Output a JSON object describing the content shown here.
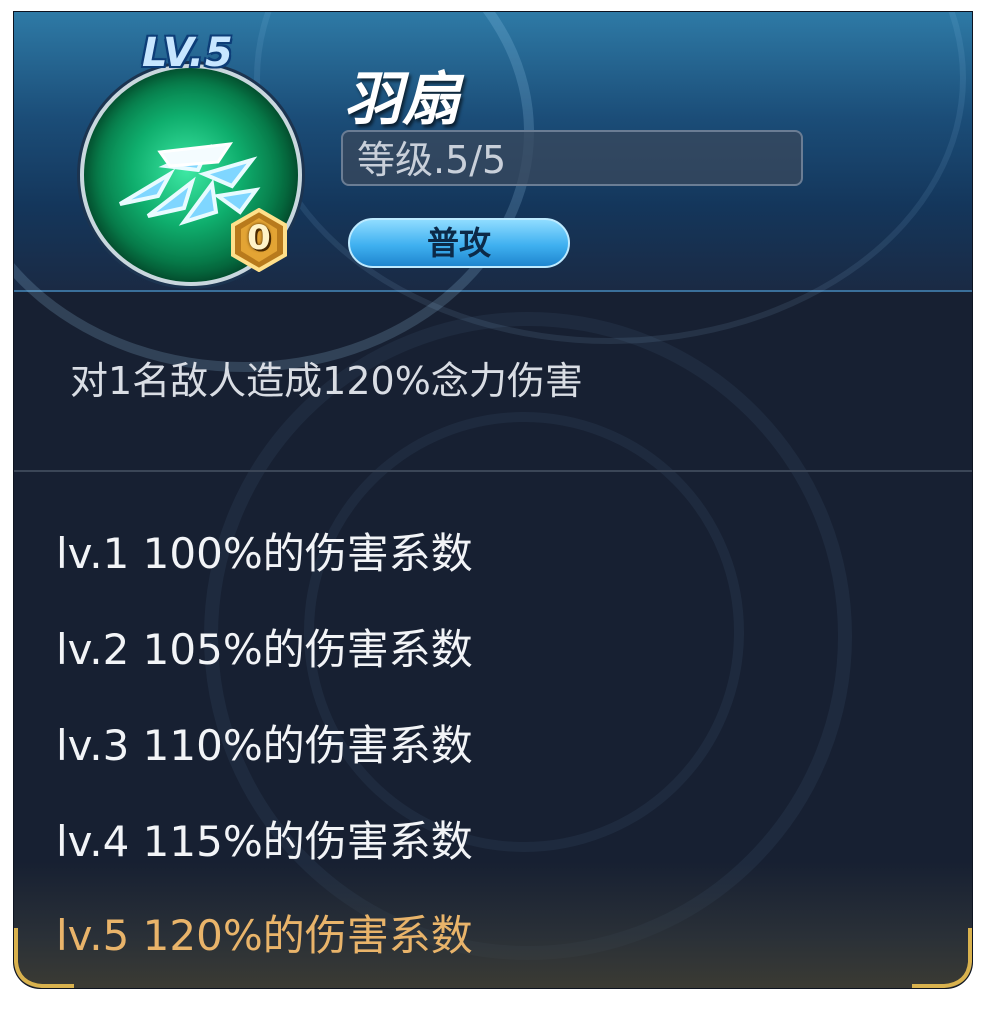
{
  "skill": {
    "level_badge": "LV.5",
    "name": "羽扇",
    "level_text": "等级.5/5",
    "badge_count": "0",
    "type_label": "普攻",
    "description": "对1名敌人造成120%念力伤害"
  },
  "levels": [
    {
      "text": "lv.1 100%的伤害系数",
      "current": false
    },
    {
      "text": "lv.2 105%的伤害系数",
      "current": false
    },
    {
      "text": "lv.3 110%的伤害系数",
      "current": false
    },
    {
      "text": "lv.4 115%的伤害系数",
      "current": false
    },
    {
      "text": "lv.5 120%的伤害系数",
      "current": true
    }
  ],
  "colors": {
    "panel_bg": "#172032",
    "level_text": "#f2f4f7",
    "current_level_text": "#e9b46a",
    "pill": "#3fb0f0"
  },
  "icons": {
    "skill_icon": "feather-fan-icon",
    "count_badge": "hexagon-badge-icon"
  }
}
